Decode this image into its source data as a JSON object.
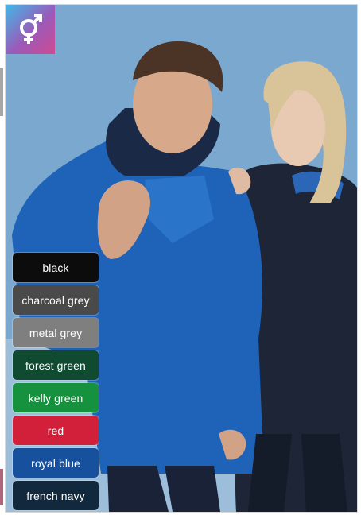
{
  "colors": [
    {
      "label": "black",
      "hex": "#0c0c0c"
    },
    {
      "label": "charcoal grey",
      "hex": "#4a4a4a"
    },
    {
      "label": "metal grey",
      "hex": "#7f7f7f"
    },
    {
      "label": "forest green",
      "hex": "#0f4a31"
    },
    {
      "label": "kelly green",
      "hex": "#16913e"
    },
    {
      "label": "red",
      "hex": "#d3203a"
    },
    {
      "label": "royal blue",
      "hex": "#17509c"
    },
    {
      "label": "french navy",
      "hex": "#12283c"
    }
  ],
  "badge": {
    "icon": "gender-unisex-icon"
  }
}
